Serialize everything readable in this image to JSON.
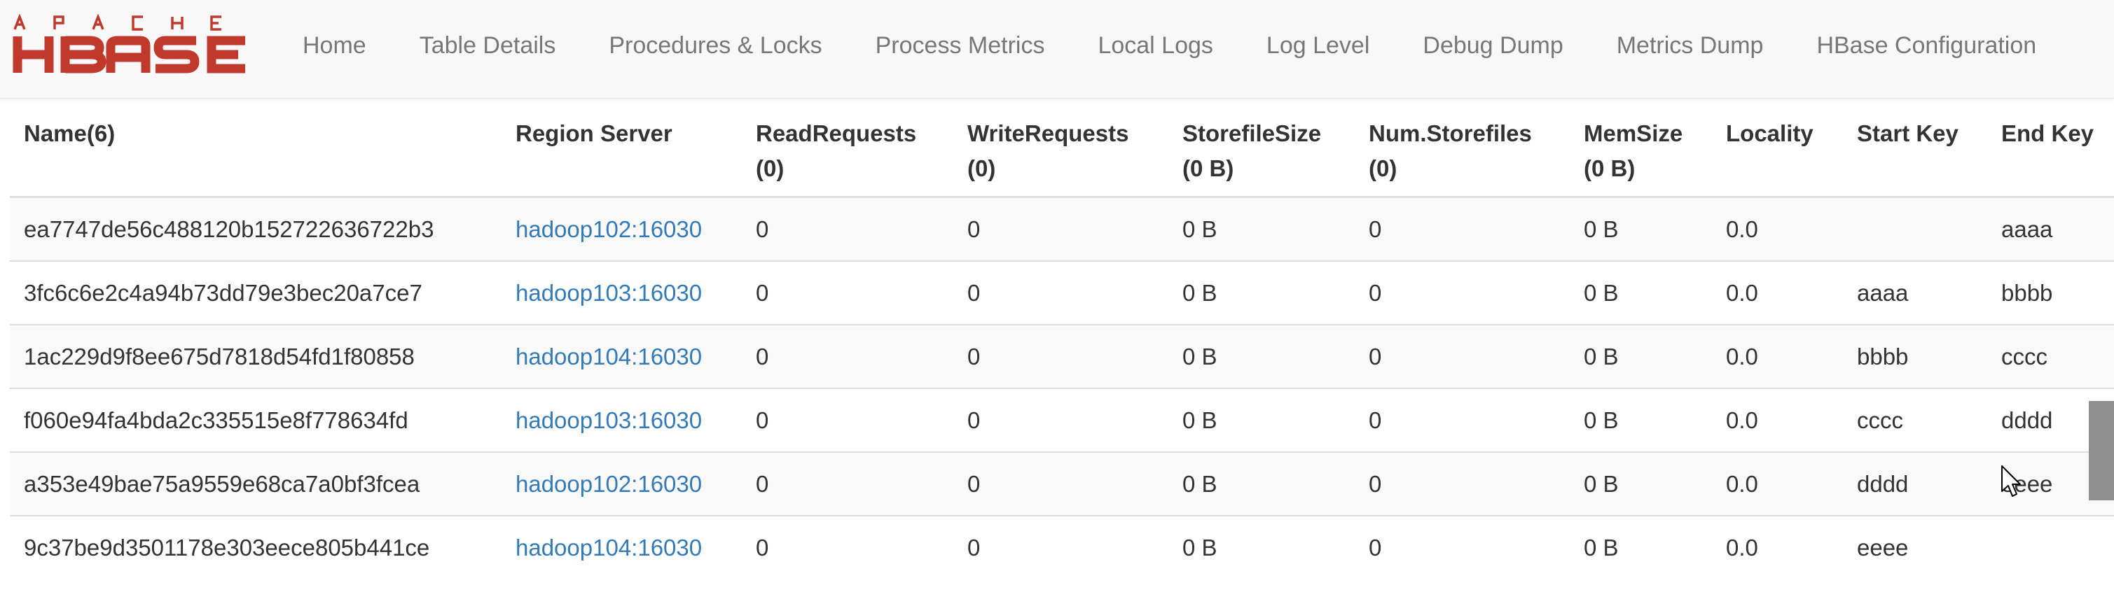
{
  "logo": {
    "top_text": "APACHE",
    "main_text": "HBASE",
    "color": "#c0392b"
  },
  "nav": {
    "items": [
      {
        "label": "Home"
      },
      {
        "label": "Table Details"
      },
      {
        "label": "Procedures & Locks"
      },
      {
        "label": "Process Metrics"
      },
      {
        "label": "Local Logs"
      },
      {
        "label": "Log Level"
      },
      {
        "label": "Debug Dump"
      },
      {
        "label": "Metrics Dump"
      },
      {
        "label": "HBase Configuration"
      }
    ]
  },
  "regions_table": {
    "headers": {
      "name": "Name(6)",
      "region_server": "Region Server",
      "read_requests": "ReadRequests",
      "read_requests_total": "(0)",
      "write_requests": "WriteRequests",
      "write_requests_total": "(0)",
      "storefile_size": "StorefileSize",
      "storefile_size_total": "(0 B)",
      "num_storefiles": "Num.Storefiles",
      "num_storefiles_total": "(0)",
      "mem_size": "MemSize",
      "mem_size_total": "(0 B)",
      "locality": "Locality",
      "start_key": "Start Key",
      "end_key": "End Key"
    },
    "rows": [
      {
        "name": "ea7747de56c488120b152722636722b3",
        "server": "hadoop102:16030",
        "read": "0",
        "write": "0",
        "storefile_size": "0 B",
        "num_storefiles": "0",
        "mem_size": "0 B",
        "locality": "0.0",
        "start_key": "",
        "end_key": "aaaa"
      },
      {
        "name": "3fc6c6e2c4a94b73dd79e3bec20a7ce7",
        "server": "hadoop103:16030",
        "read": "0",
        "write": "0",
        "storefile_size": "0 B",
        "num_storefiles": "0",
        "mem_size": "0 B",
        "locality": "0.0",
        "start_key": "aaaa",
        "end_key": "bbbb"
      },
      {
        "name": "1ac229d9f8ee675d7818d54fd1f80858",
        "server": "hadoop104:16030",
        "read": "0",
        "write": "0",
        "storefile_size": "0 B",
        "num_storefiles": "0",
        "mem_size": "0 B",
        "locality": "0.0",
        "start_key": "bbbb",
        "end_key": "cccc"
      },
      {
        "name": "f060e94fa4bda2c335515e8f778634fd",
        "server": "hadoop103:16030",
        "read": "0",
        "write": "0",
        "storefile_size": "0 B",
        "num_storefiles": "0",
        "mem_size": "0 B",
        "locality": "0.0",
        "start_key": "cccc",
        "end_key": "dddd"
      },
      {
        "name": "a353e49bae75a9559e68ca7a0bf3fcea",
        "server": "hadoop102:16030",
        "read": "0",
        "write": "0",
        "storefile_size": "0 B",
        "num_storefiles": "0",
        "mem_size": "0 B",
        "locality": "0.0",
        "start_key": "dddd",
        "end_key": "eeee"
      },
      {
        "name": "9c37be9d3501178e303eece805b441ce",
        "server": "hadoop104:16030",
        "read": "0",
        "write": "0",
        "storefile_size": "0 B",
        "num_storefiles": "0",
        "mem_size": "0 B",
        "locality": "0.0",
        "start_key": "eeee",
        "end_key": ""
      }
    ]
  },
  "colors": {
    "link": "#337ab7",
    "nav_text": "#777777",
    "header_bg": "#f8f8f8",
    "stripe": "#f9f9f9"
  },
  "icons": [
    "apache-hbase-logo",
    "mouse-pointer-icon"
  ]
}
